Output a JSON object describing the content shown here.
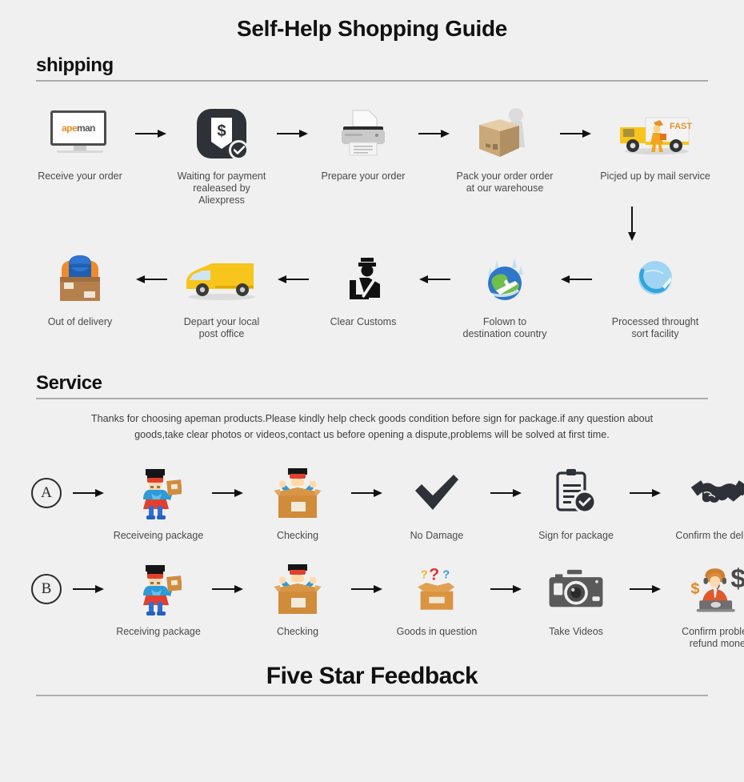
{
  "page": {
    "main_title": "Self-Help Shopping Guide",
    "bottom_title": "Five Star Feedback",
    "background_color": "#f0f0f0"
  },
  "shipping": {
    "heading": "shipping",
    "row1": [
      {
        "caption": "Receive your order",
        "icon": "monitor-apeman-icon",
        "logo_first": "ape",
        "logo_second": "man"
      },
      {
        "caption": "Waiting for payment\nrealeased by Aliexpress",
        "icon": "payment-released-icon"
      },
      {
        "caption": "Prepare your order",
        "icon": "printer-icon"
      },
      {
        "caption": "Pack your order order\nat our warehouse",
        "icon": "pack-box-worker-icon"
      },
      {
        "caption": "Picjed up by mail service",
        "icon": "fast-delivery-truck-icon",
        "truck_label": "FAST"
      }
    ],
    "row2": [
      {
        "caption": "Out of delivery",
        "icon": "delivery-person-box-icon"
      },
      {
        "caption": "Depart your local\npost office",
        "icon": "yellow-van-icon"
      },
      {
        "caption": "Clear Customs",
        "icon": "customs-officer-icon"
      },
      {
        "caption": "Folown to\ndestination country",
        "icon": "globe-airplane-icon"
      },
      {
        "caption": "Processed throught\nsort facility",
        "icon": "globe-sort-facility-icon"
      }
    ]
  },
  "service": {
    "heading": "Service",
    "paragraph_line1": "Thanks for choosing apeman products.Please kindly help check goods condition before sign for package.if any question about",
    "paragraph_line2": "goods,take clear photos or videos,contact us before opening a dispute,problems will be solved at first time.",
    "row_a": {
      "label": "A",
      "steps": [
        {
          "caption": "Receiveing package",
          "icon": "superhero-package-icon"
        },
        {
          "caption": "Checking",
          "icon": "hero-in-box-icon"
        },
        {
          "caption": "No Damage",
          "icon": "checkmark-icon"
        },
        {
          "caption": "Sign for package",
          "icon": "clipboard-check-icon"
        },
        {
          "caption": "Confirm the delivery",
          "icon": "handshake-icon"
        }
      ]
    },
    "row_b": {
      "label": "B",
      "steps": [
        {
          "caption": "Receiving package",
          "icon": "superhero-package-icon"
        },
        {
          "caption": "Checking",
          "icon": "hero-in-box-icon"
        },
        {
          "caption": "Goods in question",
          "icon": "question-box-icon"
        },
        {
          "caption": "Take Videos",
          "icon": "camera-icon"
        },
        {
          "caption": "Confirm problem,\nrefund money",
          "icon": "support-agent-dollar-icon"
        }
      ]
    }
  },
  "colors": {
    "brand_orange": "#e8912a",
    "dark": "#2e3138",
    "truck_yellow": "#f9c316",
    "hero_blue": "#2e9bd6",
    "hero_red": "#e2402f",
    "box_tan": "#d3a15e"
  }
}
